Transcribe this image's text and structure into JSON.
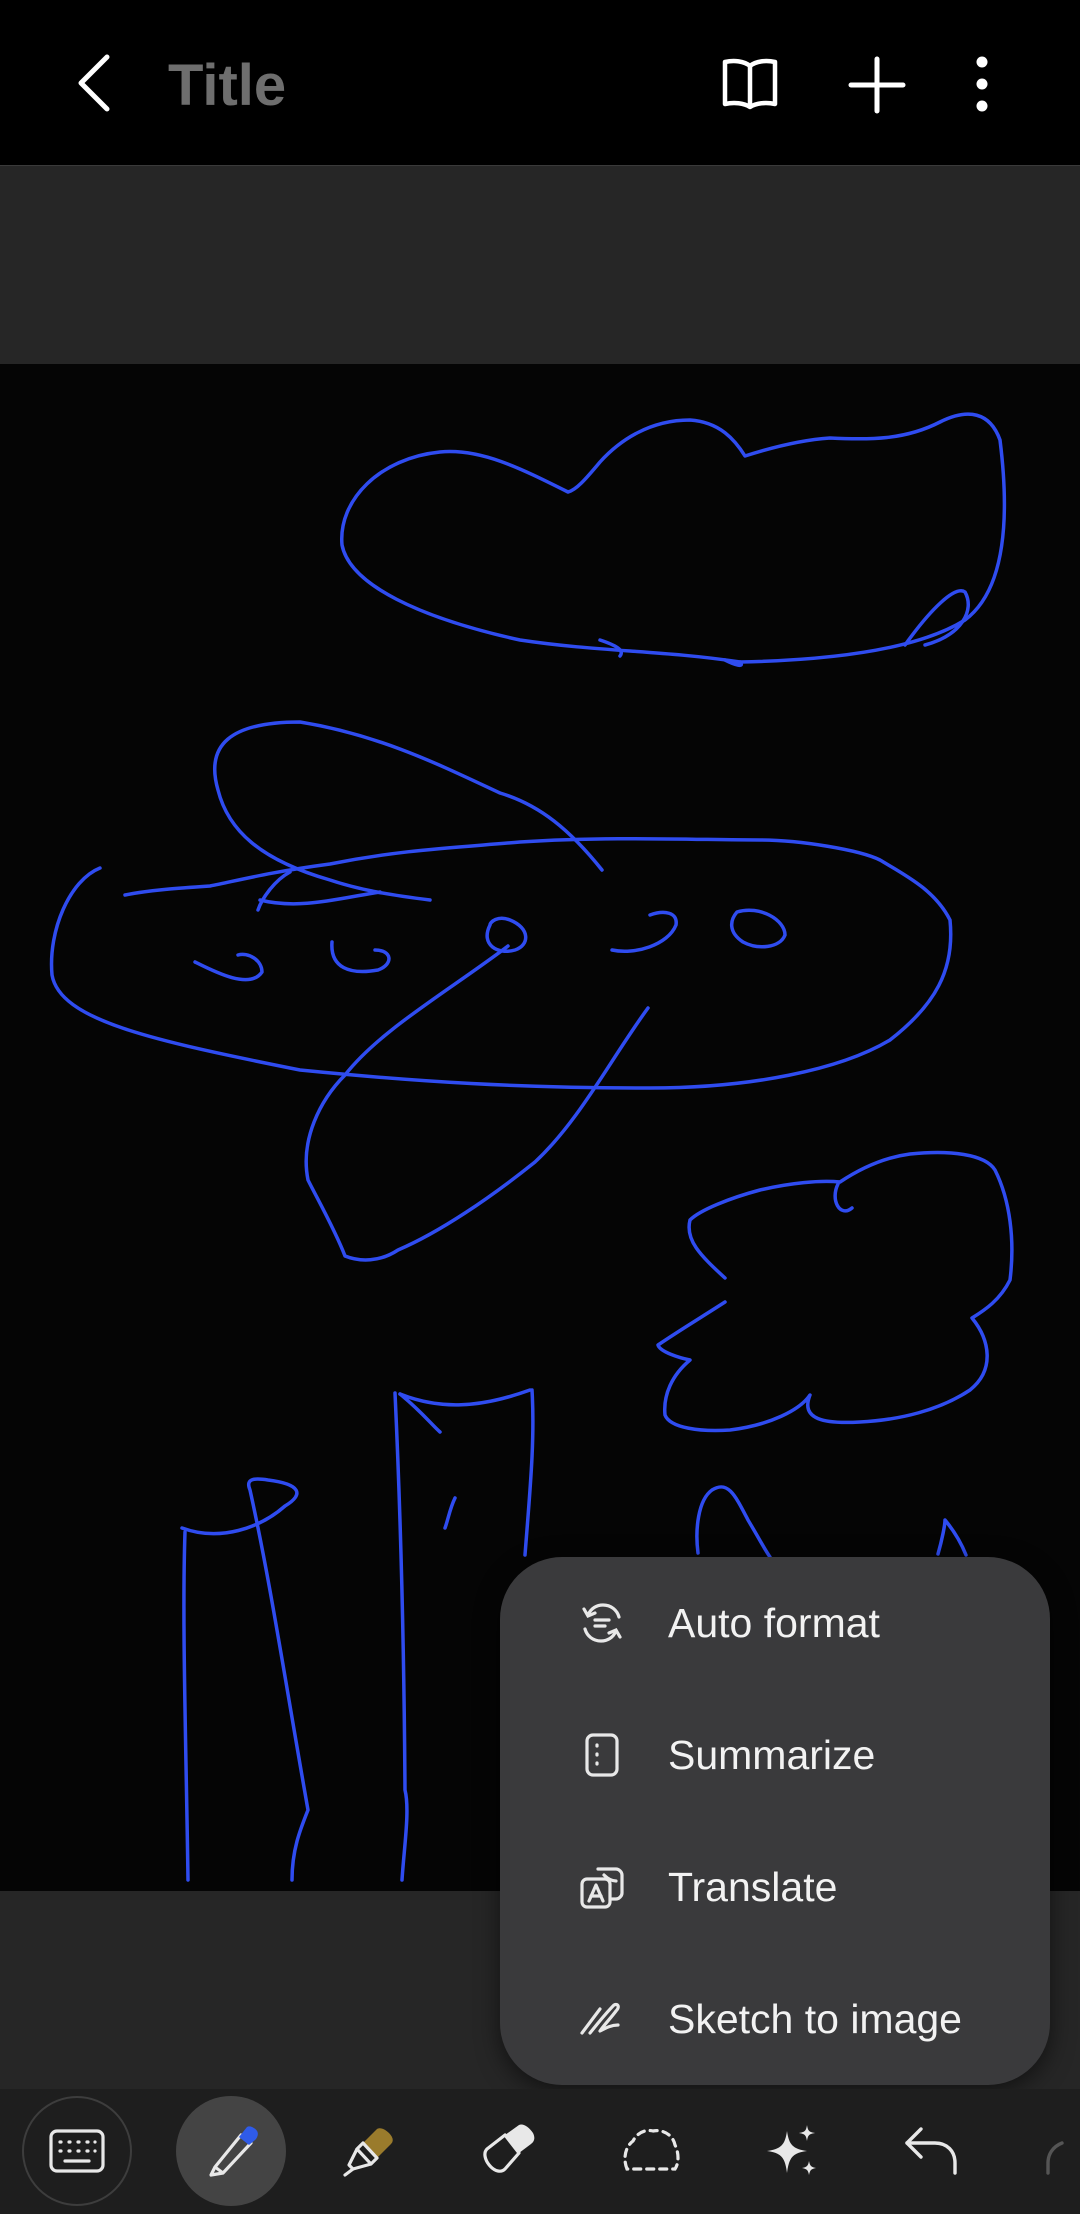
{
  "header": {
    "title": "Title"
  },
  "menu": {
    "items": [
      {
        "label": "Auto format",
        "icon": "auto-format-icon"
      },
      {
        "label": "Summarize",
        "icon": "summarize-icon"
      },
      {
        "label": "Translate",
        "icon": "translate-icon"
      },
      {
        "label": "Sketch to image",
        "icon": "sketch-to-image-icon"
      }
    ]
  },
  "toolbar": {
    "tools": [
      "keyboard-icon",
      "pen-icon",
      "highlighter-icon",
      "eraser-icon",
      "lasso-select-icon",
      "ai-sparkle-icon",
      "undo-icon"
    ],
    "active_tool": "pen-icon"
  },
  "colors": {
    "ink": "#2f4cf0",
    "pen_tip": "#2f5be8",
    "highlighter_tip": "#9a7b2c",
    "menu_bg": "#3a3a3c",
    "band_bg": "#262626"
  }
}
